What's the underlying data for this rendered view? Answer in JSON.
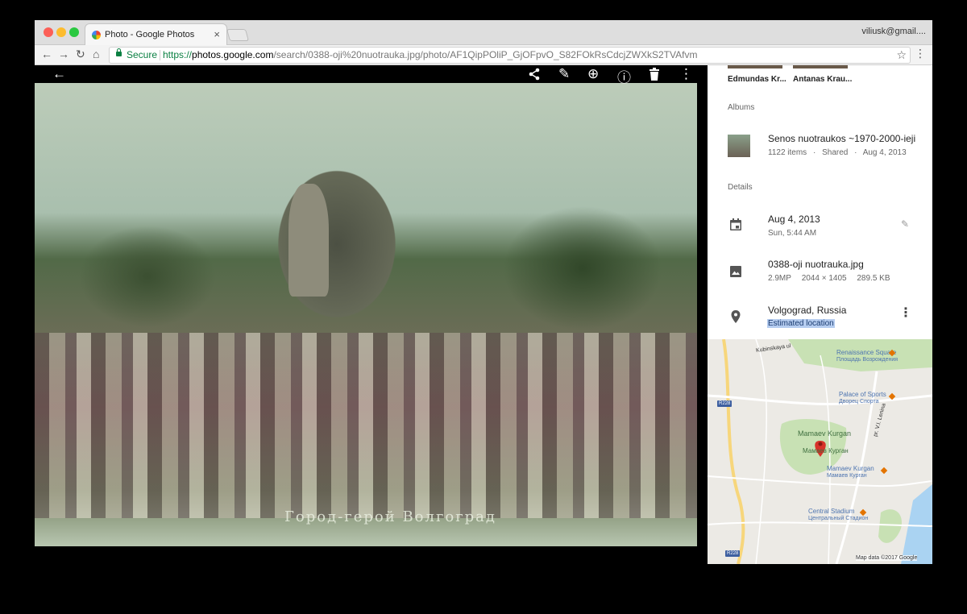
{
  "browser": {
    "tab_title": "Photo - Google Photos",
    "tab_close": "×",
    "user": "viliusk@gmail....",
    "secure_label": "Secure",
    "url_scheme": "https://",
    "url_host": "photos.google.com",
    "url_path": "/search/0388-oji%20nuotrauka.jpg/photo/AF1QipPOliP_GjOFpvO_S82FOkRsCdcjZWXkS2TVAfvm",
    "nav": {
      "back": "←",
      "forward": "→",
      "reload": "↻",
      "home": "⌂",
      "star": "☆",
      "menu": "⋮"
    }
  },
  "photo": {
    "caption": "Город-герой Волгоград",
    "toolbar": {
      "back": "←",
      "share": "share-icon",
      "edit": "✎",
      "zoom": "⊕",
      "info": "ⓘ",
      "delete": "🗑",
      "more": "⋮"
    }
  },
  "info": {
    "people": [
      {
        "name": "Edmundas Kr..."
      },
      {
        "name": "Antanas Krau..."
      }
    ],
    "albums_heading": "Albums",
    "album": {
      "title": "Senos nuotraukos ~1970-2000-ieji",
      "items": "1122 items",
      "shared": "Shared",
      "date": "Aug 4, 2013",
      "dot": "·"
    },
    "details_heading": "Details",
    "date": {
      "main": "Aug 4, 2013",
      "sub": "Sun, 5:44 AM"
    },
    "file": {
      "name": "0388-oji nuotrauka.jpg",
      "mp": "2.9MP",
      "dims": "2044 × 1405",
      "size": "289.5 KB"
    },
    "location": {
      "name": "Volgograd, Russia",
      "estimated": "Estimated location"
    },
    "edit_icon": "✎",
    "more_icon": "⋮"
  },
  "map": {
    "labels": {
      "street1": "Kubinskaya ul",
      "renaissance_en": "Renaissance Square",
      "renaissance_ru": "Площадь Возрождения",
      "palace_en": "Palace of Sports",
      "palace_ru": "Дворец Спорта",
      "mamaev_big_en": "Mamaev Kurgan",
      "mamaev_big_ru": "Мамаев Курган",
      "mamaev_en": "Mamaev Kurgan",
      "mamaev_ru": "Мамаев Курган",
      "stadium_en": "Central Stadium",
      "stadium_ru": "Центральный Стадион",
      "lenina": "pr. V.I. Lenina",
      "r228a": "R228",
      "r228b": "R228",
      "credit": "Map data ©2017 Google"
    },
    "colors": {
      "park": "#c8e1b4",
      "water": "#aad3f2",
      "road": "#ffffff",
      "highway": "#f7d67b",
      "pin": "#d8332a"
    }
  }
}
